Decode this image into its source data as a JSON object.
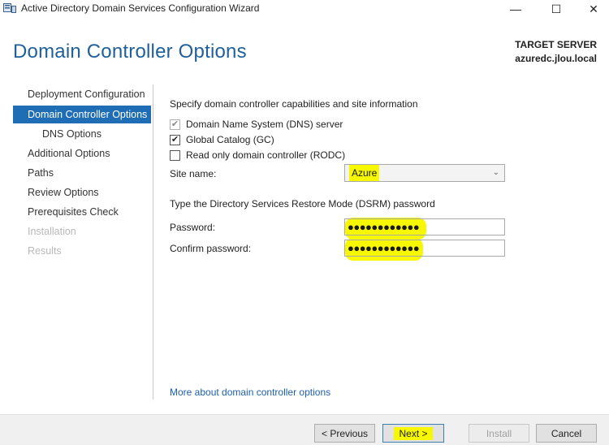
{
  "window": {
    "title": "Active Directory Domain Services Configuration Wizard",
    "minimize_glyph": "—",
    "maximize_glyph": "☐",
    "close_glyph": "✕"
  },
  "header": {
    "page_title": "Domain Controller Options",
    "target_server_label": "TARGET SERVER",
    "target_server_name": "azuredc.jlou.local"
  },
  "sidebar": {
    "items": [
      {
        "label": "Deployment Configuration",
        "state": "normal"
      },
      {
        "label": "Domain Controller Options",
        "state": "active"
      },
      {
        "label": "DNS Options",
        "state": "normal"
      },
      {
        "label": "Additional Options",
        "state": "normal"
      },
      {
        "label": "Paths",
        "state": "normal"
      },
      {
        "label": "Review Options",
        "state": "normal"
      },
      {
        "label": "Prerequisites Check",
        "state": "normal"
      },
      {
        "label": "Installation",
        "state": "disabled"
      },
      {
        "label": "Results",
        "state": "disabled"
      }
    ]
  },
  "main": {
    "capabilities_heading": "Specify domain controller capabilities and site information",
    "checkboxes": [
      {
        "label": "Domain Name System (DNS) server",
        "checked": true,
        "enabled": false
      },
      {
        "label": "Global Catalog (GC)",
        "checked": true,
        "enabled": true
      },
      {
        "label": "Read only domain controller (RODC)",
        "checked": false,
        "enabled": true
      }
    ],
    "site_name_label": "Site name:",
    "site_name_value": "Azure",
    "dsrm_heading": "Type the Directory Services Restore Mode (DSRM) password",
    "password_label": "Password:",
    "password_value": "●●●●●●●●●●●●",
    "confirm_password_label": "Confirm password:",
    "confirm_password_value": "●●●●●●●●●●●●",
    "more_link": "More about domain controller options"
  },
  "footer": {
    "previous_label": "< Previous",
    "next_label": "Next >",
    "install_label": "Install",
    "cancel_label": "Cancel"
  },
  "colors": {
    "accent": "#1f6eb5",
    "title": "#1f5f9a",
    "highlight": "#f7f700",
    "link": "#1f5fa8"
  }
}
